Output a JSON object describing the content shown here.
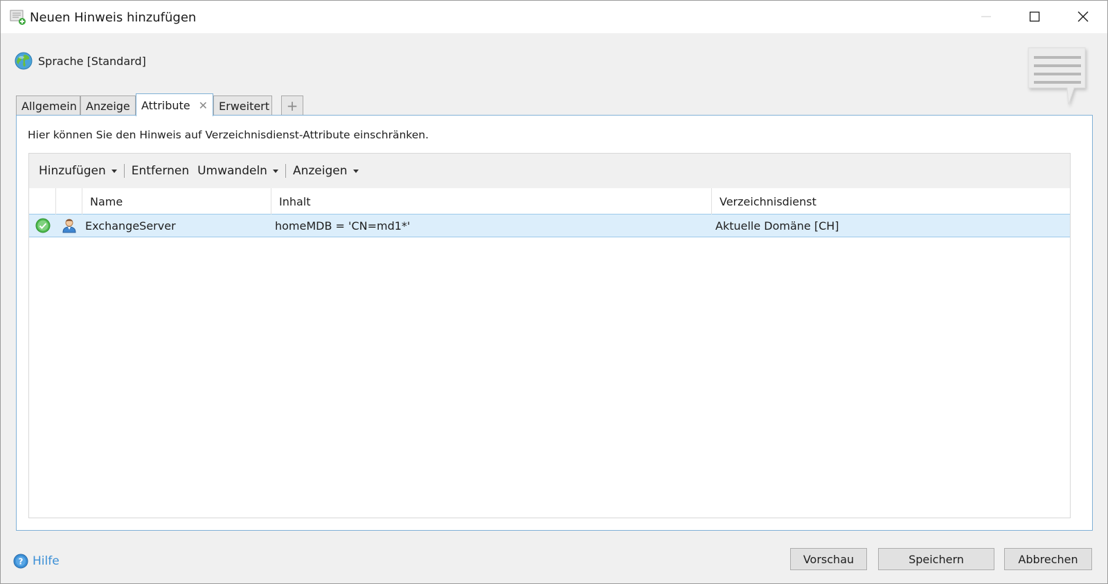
{
  "window": {
    "title": "Neuen Hinweis hinzufügen",
    "minimize_icon": "minimize-icon",
    "maximize_icon": "maximize-icon",
    "close_icon": "close-icon"
  },
  "language": {
    "label": "Sprache [Standard]",
    "icon": "globe-icon"
  },
  "tabs": [
    {
      "label": "Allgemein",
      "active": false
    },
    {
      "label": "Anzeige",
      "active": false
    },
    {
      "label": "Attribute",
      "active": true,
      "closable": true
    },
    {
      "label": "Erweitert",
      "active": false
    },
    {
      "label": "+",
      "role": "add-tab"
    }
  ],
  "panel": {
    "description": "Hier können Sie den Hinweis auf Verzeichnisdienst-Attribute einschränken."
  },
  "toolbar": {
    "add_label": "Hinzufügen",
    "remove_label": "Entfernen",
    "convert_label": "Umwandeln",
    "show_label": "Anzeigen"
  },
  "grid": {
    "columns": [
      "",
      "",
      "Name",
      "Inhalt",
      "Verzeichnisdienst"
    ],
    "rows": [
      {
        "status_icon": "check-circle-icon",
        "type_icon": "user-icon",
        "name": "ExchangeServer",
        "content": "homeMDB = 'CN=md1*'",
        "directory": "Aktuelle Domäne [CH]",
        "selected": true
      }
    ]
  },
  "footer": {
    "help_label": "Hilfe",
    "preview_label": "Vorschau",
    "save_label": "Speichern",
    "cancel_label": "Abbrechen"
  },
  "colors": {
    "accent_border": "#7fb0d6",
    "selected_row": "#dceefb",
    "link": "#3b8fd6"
  }
}
